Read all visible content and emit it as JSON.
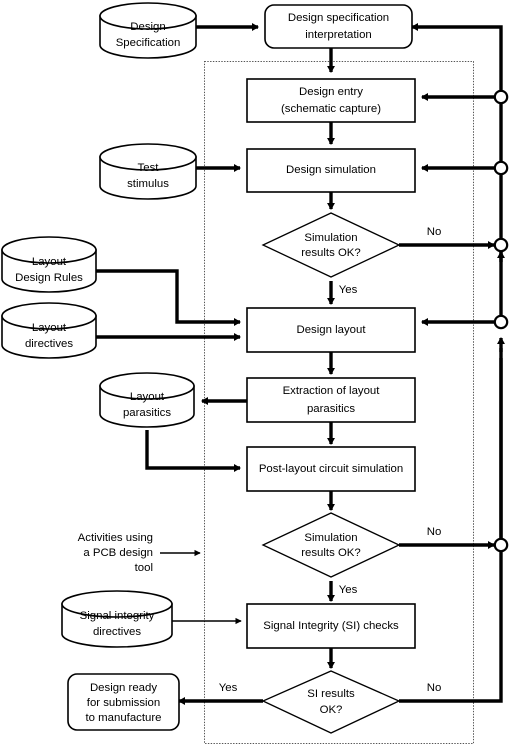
{
  "diagram": {
    "title": "PCB design flow",
    "boundary_label_lines": [
      "Activities using",
      "a PCB design",
      "tool"
    ],
    "colors": {
      "stroke": "#000000",
      "fill": "#ffffff",
      "boundary": "#555555"
    }
  },
  "nodes": {
    "design_specification": {
      "type": "cylinder",
      "lines": [
        "Design",
        "Specification"
      ]
    },
    "design_spec_interpretation": {
      "type": "rounded-process",
      "lines": [
        "Design specification",
        "interpretation"
      ]
    },
    "design_entry": {
      "type": "process",
      "lines": [
        "Design entry",
        "(schematic capture)"
      ]
    },
    "test_stimulus": {
      "type": "cylinder",
      "lines": [
        "Test",
        "stimulus"
      ]
    },
    "design_simulation": {
      "type": "process",
      "lines": [
        "Design simulation"
      ]
    },
    "simulation_results_ok_1": {
      "type": "decision",
      "lines": [
        "Simulation",
        "results OK?"
      ]
    },
    "layout_design_rules": {
      "type": "cylinder",
      "lines": [
        "Layout",
        "Design Rules"
      ]
    },
    "layout_directives": {
      "type": "cylinder",
      "lines": [
        "Layout",
        "directives"
      ]
    },
    "design_layout": {
      "type": "process",
      "lines": [
        "Design layout"
      ]
    },
    "extraction_of_layout_parasitics": {
      "type": "process",
      "lines": [
        "Extraction of layout",
        "parasitics"
      ]
    },
    "layout_parasitics": {
      "type": "cylinder",
      "lines": [
        "Layout",
        "parasitics"
      ]
    },
    "post_layout_circuit_simulation": {
      "type": "process",
      "lines": [
        "Post-layout circuit simulation"
      ]
    },
    "simulation_results_ok_2": {
      "type": "decision",
      "lines": [
        "Simulation",
        "results OK?"
      ]
    },
    "signal_integrity_directives": {
      "type": "cylinder",
      "lines": [
        "Signal integrity",
        "directives"
      ]
    },
    "signal_integrity_checks": {
      "type": "process",
      "lines": [
        "Signal Integrity (SI) checks"
      ]
    },
    "si_results_ok": {
      "type": "decision",
      "lines": [
        "SI results",
        "OK?"
      ]
    },
    "design_ready": {
      "type": "rounded-process",
      "lines": [
        "Design ready",
        "for submission",
        "to manufacture"
      ]
    }
  },
  "edge_labels": {
    "sim1_no": "No",
    "sim1_yes": "Yes",
    "sim2_no": "No",
    "sim2_yes": "Yes",
    "si_no": "No",
    "si_yes": "Yes"
  }
}
